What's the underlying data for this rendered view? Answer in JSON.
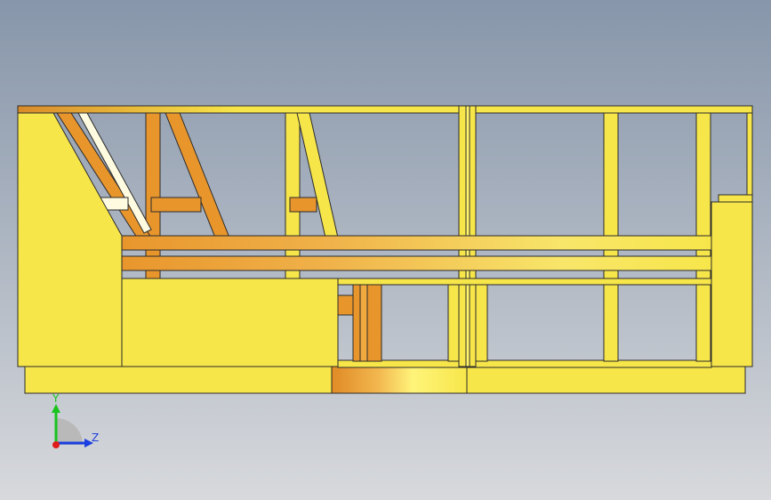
{
  "viewport": {
    "name": "cad-graphics-area",
    "colors": {
      "bg_top": "#8796aa",
      "bg_bottom": "#d7d9dc",
      "yellow": "#f7e64a",
      "yellow_light": "#fff46e",
      "orange": "#e8962c",
      "orange_dark": "#c9781d",
      "edge": "#2b2b2b",
      "highlight": "#fffbe0"
    }
  },
  "triad": {
    "y_label": "Y",
    "z_label": "Z",
    "y_color": "#19c31e",
    "z_color": "#1b3fe0",
    "x_color": "#e01b1b"
  }
}
